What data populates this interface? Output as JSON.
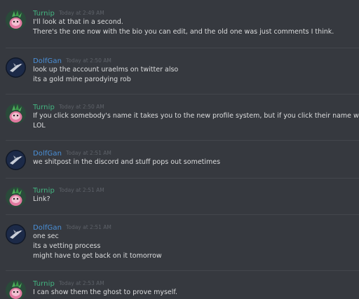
{
  "colors": {
    "background": "#36393f",
    "divider": "#43464c",
    "turnip_name": "#43b581",
    "dolfgan_name": "#4a90d9",
    "message_text": "#dcddde",
    "timestamp": "#5d6168"
  },
  "messages": [
    {
      "author": "Turnip",
      "author_color": "#43b581",
      "avatar_icon": "turnip-avatar-icon",
      "timestamp": "Today at 2:49 AM",
      "lines": [
        "I'll look at that in a second.",
        "There's the one now with the bio you can edit, and the old one was just comments I think."
      ]
    },
    {
      "author": "DolfGan",
      "author_color": "#4a90d9",
      "avatar_icon": "dolfgan-avatar-icon",
      "timestamp": "Today at 2:50 AM",
      "lines": [
        "look up the account uraelms on twitter also",
        "its a gold mine parodying rob"
      ]
    },
    {
      "author": "Turnip",
      "author_color": "#43b581",
      "avatar_icon": "turnip-avatar-icon",
      "timestamp": "Today at 2:50 AM",
      "lines": [
        "If you click somebody's name it takes you to the new profile system, but if you click their name when you're @me",
        "LOL"
      ]
    },
    {
      "author": "DolfGan",
      "author_color": "#4a90d9",
      "avatar_icon": "dolfgan-avatar-icon",
      "timestamp": "Today at 2:51 AM",
      "lines": [
        "we shitpost in the discord and stuff pops out sometimes"
      ]
    },
    {
      "author": "Turnip",
      "author_color": "#43b581",
      "avatar_icon": "turnip-avatar-icon",
      "timestamp": "Today at 2:51 AM",
      "lines": [
        "Link?"
      ]
    },
    {
      "author": "DolfGan",
      "author_color": "#4a90d9",
      "avatar_icon": "dolfgan-avatar-icon",
      "timestamp": "Today at 2:51 AM",
      "lines": [
        "one sec",
        "its a vetting process",
        "might have to get back on it tomorrow"
      ]
    },
    {
      "author": "Turnip",
      "author_color": "#43b581",
      "avatar_icon": "turnip-avatar-icon",
      "timestamp": "Today at 2:53 AM",
      "lines": [
        "I can show them the ghost to prove myself."
      ]
    }
  ]
}
